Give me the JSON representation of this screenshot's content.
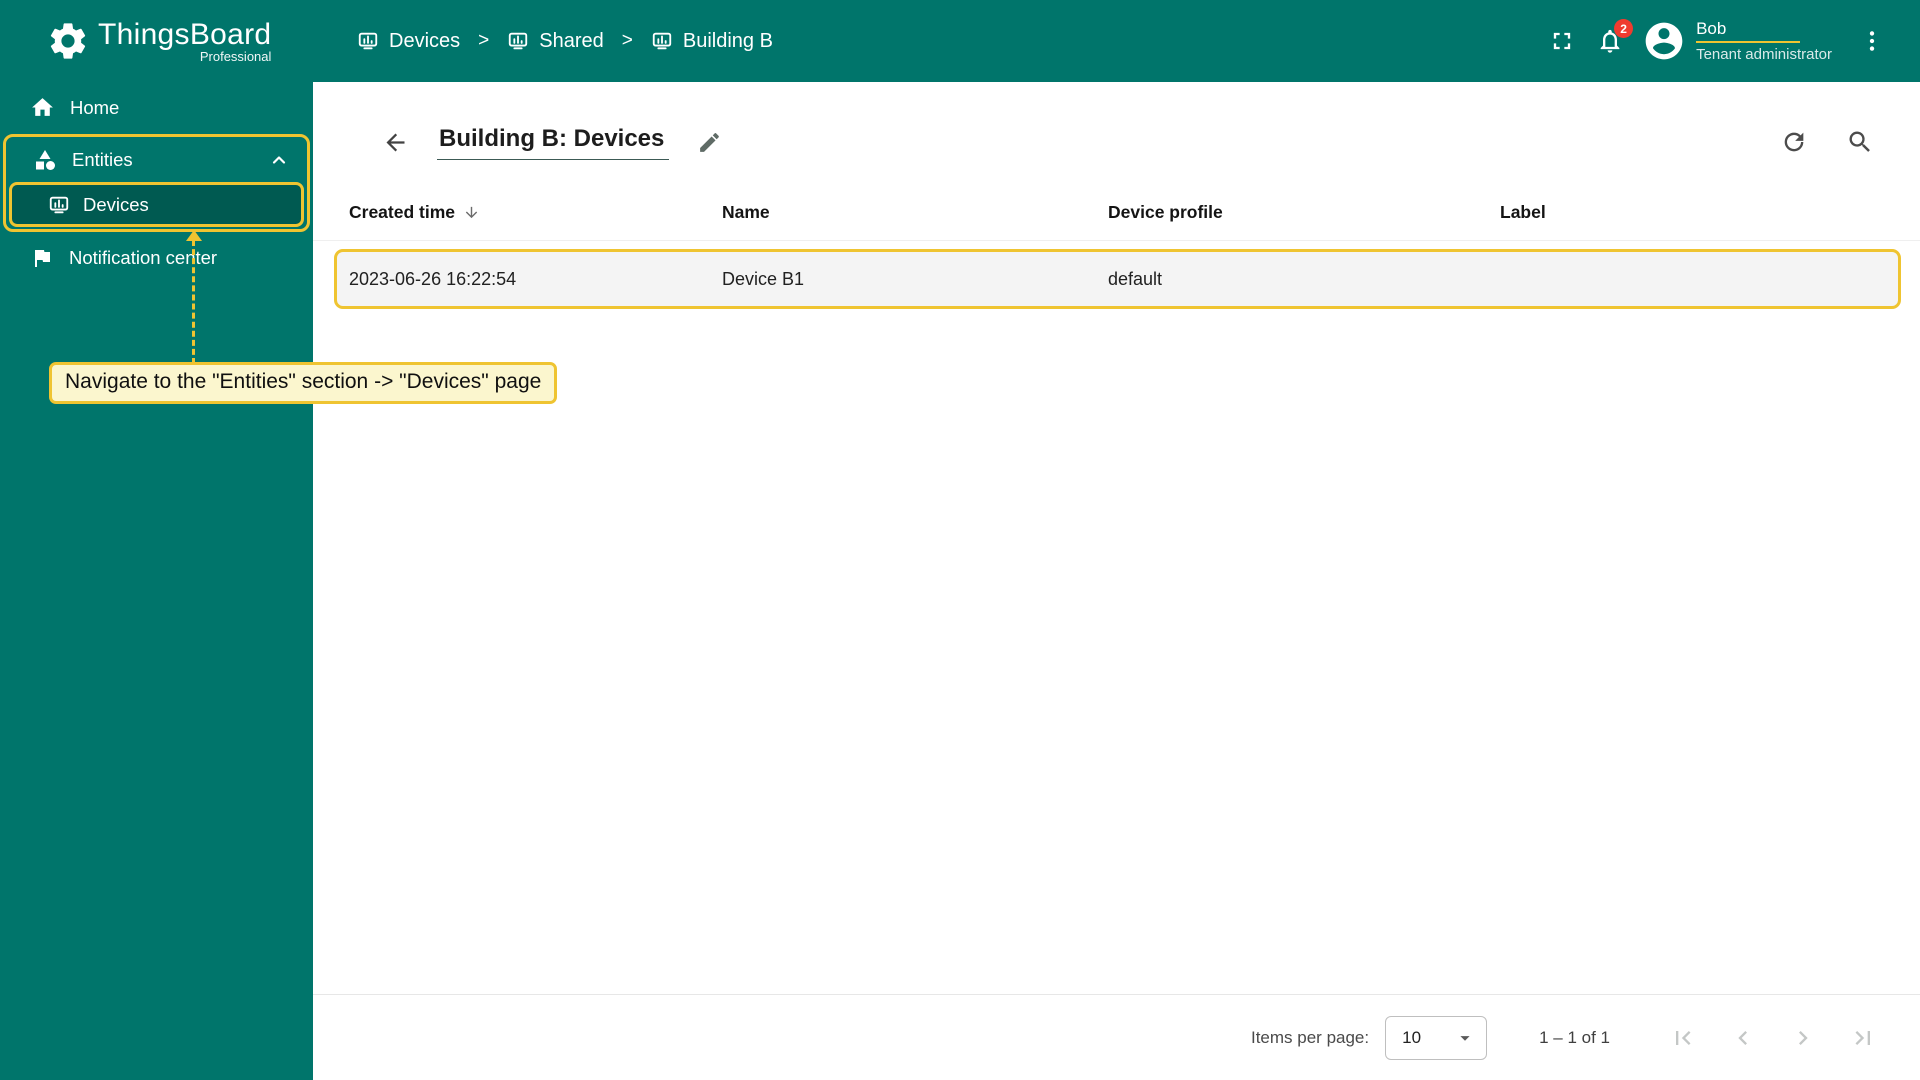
{
  "app": {
    "name": "ThingsBoard",
    "edition": "Professional"
  },
  "colors": {
    "teal": "#00756B",
    "teal_dark": "#005A51",
    "highlight_yellow": "#EFC431",
    "tooltip_bg": "#FBF6CE",
    "badge_red": "#EF3B2F"
  },
  "header": {
    "separator": ">",
    "breadcrumb": [
      {
        "label": "Devices",
        "icon": "devices-icon"
      },
      {
        "label": "Shared",
        "icon": "devices-icon"
      },
      {
        "label": "Building B",
        "icon": "devices-icon"
      }
    ],
    "notifications_badge": "2",
    "user": {
      "name": "Bob",
      "role": "Tenant administrator"
    },
    "icons": [
      "fullscreen-icon",
      "bell-icon",
      "avatar-icon",
      "kebab-menu-icon"
    ]
  },
  "sidebar": {
    "items": [
      {
        "label": "Home",
        "icon": "home-icon"
      },
      {
        "label": "Entities",
        "icon": "entities-icon",
        "expanded": true
      },
      {
        "label": "Devices",
        "icon": "devices-icon",
        "selected": true
      },
      {
        "label": "Notification center",
        "icon": "flag-icon"
      }
    ]
  },
  "main": {
    "title": "Building B: Devices",
    "toolbar_icons": [
      "back-arrow-icon",
      "edit-pencil-icon",
      "refresh-icon",
      "search-icon"
    ],
    "table": {
      "columns": [
        "Created time",
        "Name",
        "Device profile",
        "Label"
      ],
      "sorted_column": "Created time",
      "sort_direction": "desc",
      "rows": [
        {
          "created_time": "2023-06-26 16:22:54",
          "name": "Device B1",
          "device_profile": "default",
          "label": ""
        }
      ]
    },
    "pagination": {
      "items_per_page_label": "Items per page:",
      "items_per_page_value": "10",
      "range": "1 – 1 of 1"
    }
  },
  "annotation": {
    "text": "Navigate to the \"Entities\" section -> \"Devices\" page"
  }
}
